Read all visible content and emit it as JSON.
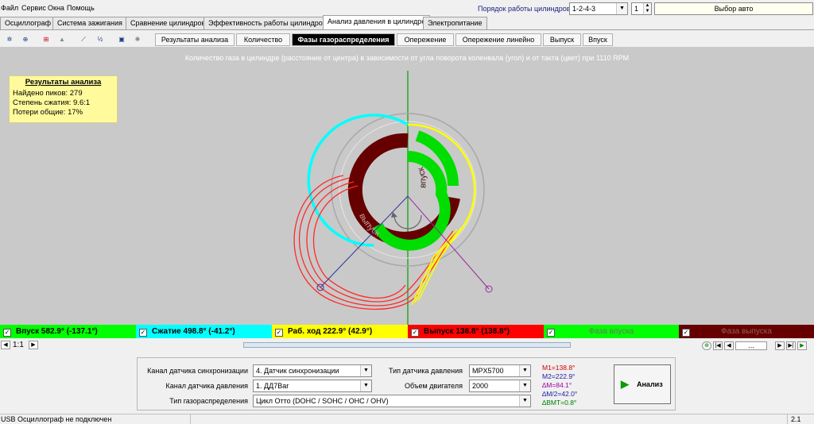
{
  "menu": [
    "Файл",
    "Сервис",
    "Окна",
    "Помощь"
  ],
  "cylinder_order": {
    "label": "Порядок работы цилиндров",
    "value": "1-2-4-3",
    "cyl": "1"
  },
  "vehicle_button": "Выбор авто",
  "tabs": [
    "Осциллограф",
    "Система зажигания",
    "Сравнение цилиндров",
    "Эффективность работы цилиндров",
    "Анализ давления в цилиндре",
    "Электропитание"
  ],
  "active_tab": 4,
  "subtabs": [
    "Результаты анализа",
    "Количество",
    "Фазы газораспределения",
    "Опережение",
    "Опережение линейно",
    "Выпуск",
    "Впуск"
  ],
  "active_subtab": 2,
  "chart_data": {
    "type": "polar",
    "title": "Количество газа в цилиндре (расстояние от центра) в зависимости от угла поворота коленвала (угол) и от такта (цвет) при 1110 RPM",
    "rpm": 1110,
    "arc_labels": [
      "впуск",
      "выпуск"
    ],
    "colors": {
      "intake": "#ffff00",
      "compression": "#00ffff",
      "power": "#00ff00",
      "exhaust": "#ff0000",
      "intake_phase": "#00ff00",
      "exhaust_phase": "#660000"
    }
  },
  "results": {
    "title": "Результаты анализа",
    "lines": [
      "Найдено пиков: 279",
      "Степень сжатия: 9.6:1",
      "Потери общие: 17%"
    ]
  },
  "legend": [
    {
      "text": "Впуск 582.9° (-137.1°)",
      "bg": "#00ff00",
      "color": "#000"
    },
    {
      "text": "Сжатие 498.8° (-41.2°)",
      "bg": "#00ffff",
      "color": "#000"
    },
    {
      "text": "Раб. ход 222.9° (42.9°)",
      "bg": "#ffff00",
      "color": "#000"
    },
    {
      "text": "Выпуск 138.8° (138.8°)",
      "bg": "#ff0000",
      "color": "#000"
    },
    {
      "text": "Фаза впуска",
      "bg": "#00ff00",
      "color": "#707070"
    },
    {
      "text": "Фаза выпуска",
      "bg": "#660000",
      "color": "#9a5a5a"
    }
  ],
  "scale": "1:1",
  "nav_dots": "...",
  "form": {
    "sync_channel_label": "Канал датчика синхронизации",
    "sync_channel_value": "4.  Датчик синхронизации",
    "pressure_channel_label": "Канал датчика давления",
    "pressure_channel_value": "1.  ДД7Bar",
    "timing_label": "Тип газораспределения",
    "timing_value": "Цикл Отто (DOHC / SOHC / OHC / OHV)",
    "sensor_type_label": "Тип датчика давления",
    "sensor_type_value": "MPX5700",
    "engine_volume_label": "Объем двигателя",
    "engine_volume_value": "2000"
  },
  "stats": [
    {
      "text": "M1=138.8°",
      "color": "#d00000"
    },
    {
      "text": "M2=222.9°",
      "color": "#1a1aa8"
    },
    {
      "text": "∆M=84.1°",
      "color": "#a000a0"
    },
    {
      "text": "∆M/2=42.0°",
      "color": "#1a1aa8"
    },
    {
      "text": "∆BMT=0.8°",
      "color": "#008000"
    }
  ],
  "analyze_button": "Анализ",
  "status": "USB Осциллограф не подключен",
  "version": "2.1"
}
